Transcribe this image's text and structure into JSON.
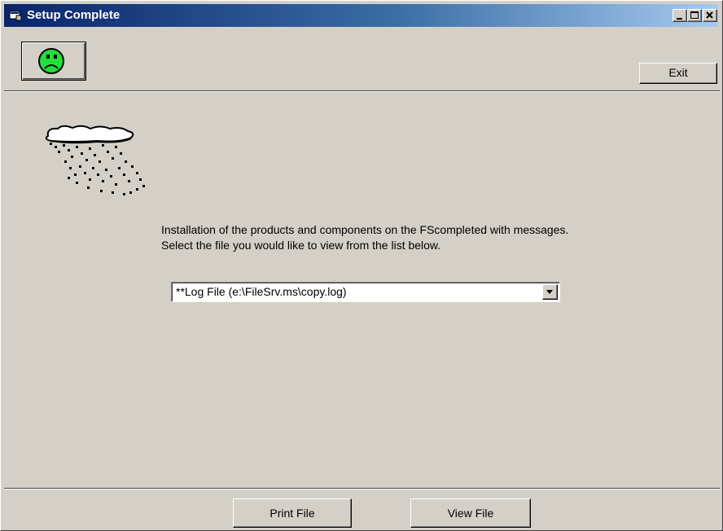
{
  "window": {
    "title": "Setup Complete",
    "controls": {
      "minimize": "minimize-icon",
      "maximize": "maximize-icon",
      "close": "close-icon"
    }
  },
  "toolbar": {
    "status_icon": "sad-face-icon",
    "exit_label": "Exit"
  },
  "main": {
    "illustration": "rain-cloud-icon",
    "message_line1": "Installation of the products and components on the FScompleted with messages.",
    "message_line2": "Select the file you would like to view from the list below.",
    "file_select": {
      "selected": "**Log File (e:\\FileSrv.ms\\copy.log)"
    }
  },
  "footer": {
    "print_label": "Print File",
    "view_label": "View File"
  },
  "colors": {
    "face": "#d4d0c8",
    "titlebar_start": "#0a246a",
    "titlebar_end": "#a6caf0",
    "smiley": "#22e03a"
  }
}
